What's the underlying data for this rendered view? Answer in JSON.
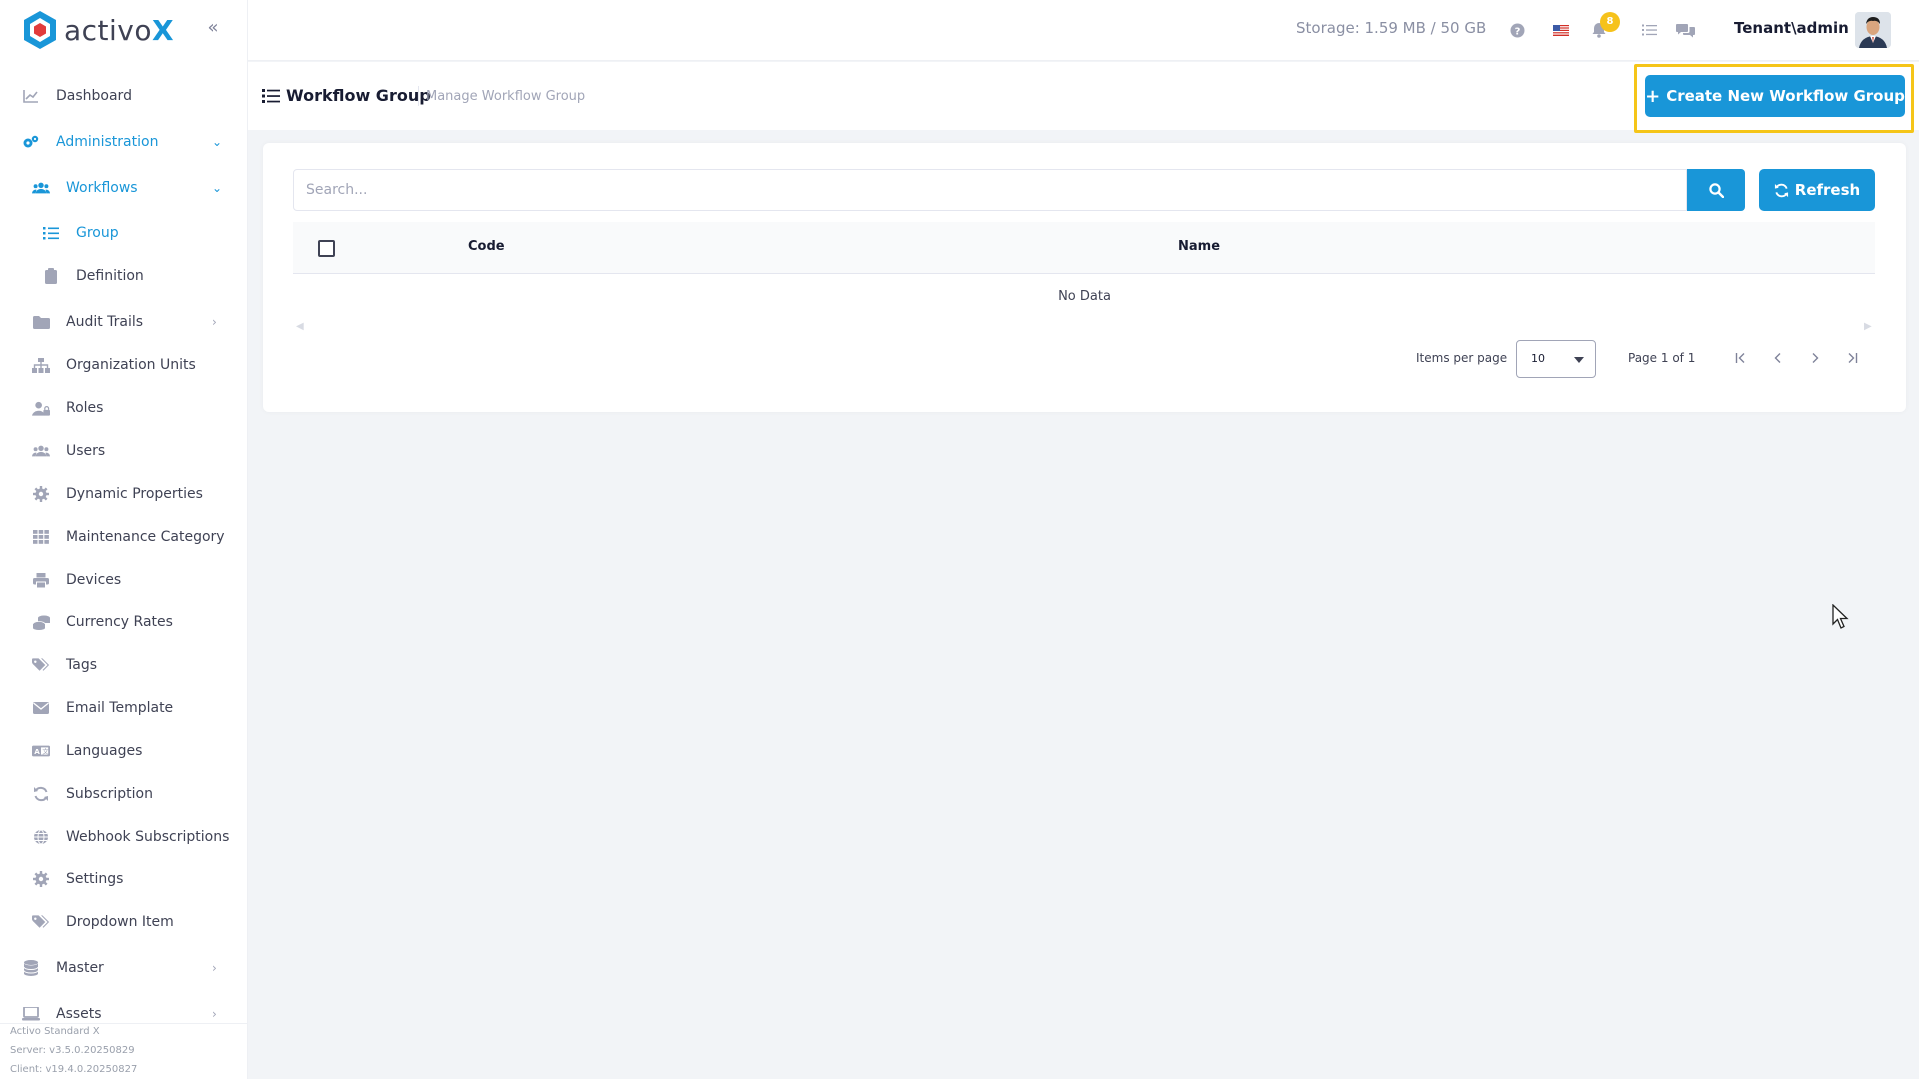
{
  "brand": {
    "name_main": "activo",
    "name_accent": "X",
    "color": "#1996d8"
  },
  "topbar": {
    "storage": "Storage: 1.59 MB / 50 GB",
    "notification_count": "8",
    "user": "Tenant\\admin",
    "icons": [
      "help-icon",
      "flag-us-icon",
      "bell-icon",
      "tasks-icon",
      "chat-icon"
    ]
  },
  "sidebar": {
    "items": [
      {
        "label": "Dashboard",
        "icon": "chart-line-icon"
      },
      {
        "label": "Administration",
        "icon": "cogs-icon"
      },
      {
        "label": "Workflows",
        "icon": "users-icon"
      },
      {
        "label": "Group",
        "icon": "list-icon"
      },
      {
        "label": "Definition",
        "icon": "clipboard-icon"
      },
      {
        "label": "Audit Trails",
        "icon": "folder-icon"
      },
      {
        "label": "Organization Units",
        "icon": "sitemap-icon"
      },
      {
        "label": "Roles",
        "icon": "user-lock-icon"
      },
      {
        "label": "Users",
        "icon": "users-icon"
      },
      {
        "label": "Dynamic Properties",
        "icon": "gear-icon"
      },
      {
        "label": "Maintenance Category",
        "icon": "grid-icon"
      },
      {
        "label": "Devices",
        "icon": "printer-icon"
      },
      {
        "label": "Currency Rates",
        "icon": "coins-icon"
      },
      {
        "label": "Tags",
        "icon": "tags-icon"
      },
      {
        "label": "Email Template",
        "icon": "envelope-icon"
      },
      {
        "label": "Languages",
        "icon": "language-icon"
      },
      {
        "label": "Subscription",
        "icon": "sync-icon"
      },
      {
        "label": "Webhook Subscriptions",
        "icon": "globe-icon"
      },
      {
        "label": "Settings",
        "icon": "gear-icon"
      },
      {
        "label": "Dropdown Item",
        "icon": "tags-icon"
      },
      {
        "label": "Master",
        "icon": "database-icon"
      },
      {
        "label": "Assets",
        "icon": "laptop-icon"
      }
    ],
    "version": {
      "product": "Activo Standard X",
      "server": "Server: v3.5.0.20250829",
      "client": "Client: v19.4.0.20250827"
    }
  },
  "subheader": {
    "title": "Workflow Group",
    "description": "Manage Workflow Group",
    "create_button": "Create New Workflow Group"
  },
  "table": {
    "search_placeholder": "Search...",
    "refresh_label": "Refresh",
    "columns": [
      "Code",
      "Name"
    ],
    "empty_text": "No Data",
    "items_per_page_label": "Items per page",
    "items_per_page_value": "10",
    "page_info": "Page 1 of 1"
  }
}
